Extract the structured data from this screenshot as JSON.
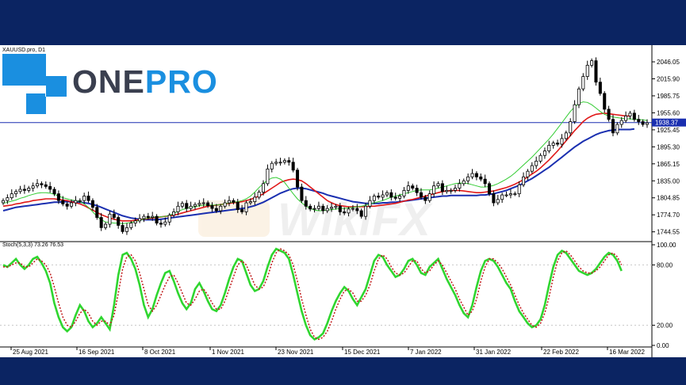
{
  "symbol_label": "XAUUSD.pro, D1",
  "brand": {
    "prefix": "ONE",
    "suffix": "PRO"
  },
  "watermark": "WikiFX",
  "current_price": "1938.37",
  "colors": {
    "frame": "#0b2462",
    "candle": "#000000",
    "ma_fast": "#33cc33",
    "ma_mid": "#e01818",
    "ma_slow": "#1a2fb0",
    "stoch_main": "#2fd62f",
    "stoch_signal": "#c01818",
    "price_line": "#1a2fb0",
    "brand_blue": "#1a8fe0",
    "brand_dark": "#3a3f4f"
  },
  "chart_data": [
    {
      "type": "candlestick",
      "title": "XAUUSD.pro, D1",
      "ylim": [
        1730,
        2070
      ],
      "y_ticks": [
        "2046.05",
        "2015.90",
        "1985.75",
        "1955.60",
        "1925.45",
        "1895.30",
        "1865.15",
        "1835.00",
        "1804.85",
        "1774.70",
        "1744.55"
      ],
      "x_ticks": [
        "25 Aug 2021",
        "16 Sep 2021",
        "8 Oct 2021",
        "1 Nov 2021",
        "23 Nov 2021",
        "15 Dec 2021",
        "7 Jan 2022",
        "31 Jan 2022",
        "22 Feb 2022",
        "16 Mar 2022"
      ],
      "close": [
        1800,
        1805,
        1812,
        1816,
        1820,
        1818,
        1822,
        1826,
        1830,
        1828,
        1825,
        1820,
        1812,
        1800,
        1794,
        1790,
        1796,
        1800,
        1800,
        1808,
        1800,
        1788,
        1770,
        1752,
        1758,
        1776,
        1770,
        1756,
        1745,
        1752,
        1760,
        1764,
        1768,
        1772,
        1770,
        1772,
        1760,
        1758,
        1762,
        1774,
        1780,
        1790,
        1795,
        1786,
        1790,
        1793,
        1795,
        1796,
        1791,
        1786,
        1782,
        1790,
        1796,
        1800,
        1797,
        1784,
        1780,
        1796,
        1798,
        1806,
        1815,
        1830,
        1856,
        1866,
        1868,
        1868,
        1871,
        1868,
        1854,
        1824,
        1800,
        1790,
        1785,
        1786,
        1790,
        1782,
        1786,
        1788,
        1790,
        1780,
        1778,
        1785,
        1786,
        1782,
        1772,
        1790,
        1800,
        1808,
        1806,
        1810,
        1814,
        1806,
        1804,
        1808,
        1818,
        1826,
        1822,
        1814,
        1806,
        1800,
        1812,
        1826,
        1830,
        1816,
        1818,
        1818,
        1822,
        1830,
        1835,
        1842,
        1848,
        1842,
        1838,
        1830,
        1812,
        1796,
        1802,
        1810,
        1810,
        1812,
        1812,
        1828,
        1842,
        1852,
        1862,
        1870,
        1880,
        1888,
        1898,
        1902,
        1900,
        1910,
        1920,
        1940,
        1970,
        1998,
        2020,
        2040,
        2048,
        2010,
        1990,
        1962,
        1944,
        1920,
        1935,
        1942,
        1950,
        1955,
        1944,
        1940,
        1935,
        1938
      ],
      "ma_fast": [
        1795,
        1797,
        1799,
        1801,
        1804,
        1806,
        1809,
        1811,
        1813,
        1814,
        1814,
        1813,
        1811,
        1808,
        1805,
        1803,
        1801,
        1800,
        1798,
        1794,
        1788,
        1780,
        1772,
        1766,
        1762,
        1761,
        1760,
        1760,
        1759,
        1760,
        1761,
        1763,
        1765,
        1767,
        1769,
        1770,
        1771,
        1771,
        1772,
        1774,
        1777,
        1781,
        1784,
        1786,
        1788,
        1789,
        1791,
        1792,
        1792,
        1792,
        1792,
        1793,
        1794,
        1796,
        1797,
        1798,
        1800,
        1803,
        1808,
        1815,
        1823,
        1830,
        1836,
        1840,
        1841,
        1838,
        1832,
        1822,
        1812,
        1803,
        1796,
        1790,
        1786,
        1783,
        1782,
        1782,
        1783,
        1784,
        1785,
        1786,
        1786,
        1787,
        1788,
        1789,
        1790,
        1792,
        1794,
        1796,
        1798,
        1800,
        1803,
        1806,
        1808,
        1810,
        1812,
        1814,
        1816,
        1818,
        1819,
        1819,
        1819,
        1820,
        1822,
        1824,
        1826,
        1828,
        1830,
        1831,
        1831,
        1830,
        1828,
        1826,
        1824,
        1824,
        1825,
        1827,
        1830,
        1834,
        1838,
        1843,
        1849,
        1856,
        1863,
        1870,
        1877,
        1885,
        1893,
        1901,
        1909,
        1918,
        1928,
        1938,
        1948,
        1958,
        1966,
        1972,
        1975,
        1974,
        1970,
        1964,
        1958,
        1953,
        1950,
        1948,
        1947,
        1946,
        1945,
        1945,
        1944,
        1944,
        1943,
        1942
      ],
      "ma_mid": [
        1790,
        1791,
        1792,
        1794,
        1795,
        1797,
        1798,
        1800,
        1801,
        1802,
        1803,
        1803,
        1803,
        1802,
        1801,
        1800,
        1798,
        1796,
        1794,
        1791,
        1787,
        1783,
        1779,
        1775,
        1772,
        1769,
        1767,
        1765,
        1764,
        1764,
        1764,
        1765,
        1766,
        1767,
        1768,
        1769,
        1770,
        1771,
        1772,
        1773,
        1774,
        1776,
        1778,
        1780,
        1782,
        1784,
        1786,
        1788,
        1790,
        1791,
        1792,
        1793,
        1794,
        1795,
        1796,
        1797,
        1798,
        1800,
        1802,
        1805,
        1808,
        1812,
        1817,
        1822,
        1827,
        1832,
        1835,
        1837,
        1838,
        1837,
        1835,
        1830,
        1824,
        1818,
        1812,
        1806,
        1800,
        1796,
        1793,
        1791,
        1790,
        1789,
        1789,
        1789,
        1789,
        1789,
        1790,
        1790,
        1791,
        1792,
        1793,
        1794,
        1795,
        1797,
        1799,
        1801,
        1802,
        1804,
        1806,
        1808,
        1810,
        1812,
        1814,
        1816,
        1817,
        1818,
        1818,
        1818,
        1817,
        1816,
        1815,
        1814,
        1814,
        1815,
        1816,
        1817,
        1819,
        1821,
        1823,
        1826,
        1829,
        1833,
        1837,
        1842,
        1847,
        1852,
        1858,
        1865,
        1872,
        1880,
        1888,
        1897,
        1906,
        1915,
        1924,
        1932,
        1940,
        1946,
        1950,
        1953,
        1954,
        1955,
        1954,
        1953,
        1952,
        1951,
        1950,
        1950
      ],
      "ma_slow": [
        1782,
        1784,
        1786,
        1788,
        1789,
        1790,
        1791,
        1792,
        1793,
        1794,
        1795,
        1796,
        1797,
        1797,
        1798,
        1798,
        1798,
        1798,
        1797,
        1796,
        1795,
        1793,
        1791,
        1788,
        1785,
        1782,
        1779,
        1776,
        1773,
        1771,
        1769,
        1768,
        1767,
        1766,
        1766,
        1766,
        1766,
        1767,
        1768,
        1769,
        1770,
        1771,
        1772,
        1773,
        1774,
        1775,
        1776,
        1777,
        1778,
        1779,
        1780,
        1781,
        1782,
        1783,
        1784,
        1785,
        1786,
        1787,
        1789,
        1791,
        1794,
        1797,
        1801,
        1805,
        1809,
        1813,
        1816,
        1819,
        1821,
        1822,
        1822,
        1821,
        1819,
        1817,
        1815,
        1813,
        1810,
        1808,
        1806,
        1804,
        1802,
        1800,
        1798,
        1797,
        1796,
        1795,
        1795,
        1795,
        1795,
        1796,
        1796,
        1797,
        1797,
        1798,
        1799,
        1800,
        1801,
        1802,
        1803,
        1804,
        1805,
        1806,
        1807,
        1808,
        1808,
        1809,
        1809,
        1809,
        1809,
        1809,
        1809,
        1809,
        1810,
        1810,
        1811,
        1812,
        1814,
        1816,
        1818,
        1821,
        1824,
        1827,
        1831,
        1835,
        1839,
        1844,
        1849,
        1854,
        1859,
        1865,
        1871,
        1877,
        1883,
        1889,
        1895,
        1900,
        1905,
        1909,
        1913,
        1917,
        1920,
        1922,
        1924,
        1925,
        1926,
        1926,
        1926,
        1926,
        1927
      ]
    },
    {
      "type": "line",
      "title": "Stoch(5,3,3) 73.26 76.53",
      "ylim": [
        0,
        100
      ],
      "y_ticks": [
        "100.00",
        "80.00",
        "20.00",
        "0.00"
      ],
      "series": [
        {
          "name": "main",
          "values": [
            80,
            78,
            82,
            86,
            80,
            76,
            80,
            86,
            88,
            82,
            74,
            62,
            42,
            28,
            18,
            14,
            18,
            30,
            40,
            34,
            24,
            18,
            22,
            28,
            22,
            16,
            40,
            70,
            90,
            92,
            86,
            76,
            60,
            40,
            28,
            36,
            50,
            62,
            72,
            74,
            64,
            52,
            42,
            36,
            42,
            56,
            62,
            54,
            44,
            36,
            34,
            40,
            52,
            66,
            78,
            86,
            84,
            72,
            60,
            54,
            56,
            64,
            78,
            90,
            96,
            94,
            92,
            86,
            70,
            52,
            34,
            20,
            10,
            6,
            8,
            12,
            22,
            34,
            44,
            52,
            58,
            54,
            46,
            40,
            48,
            56,
            70,
            84,
            90,
            88,
            80,
            74,
            68,
            70,
            76,
            84,
            86,
            80,
            72,
            70,
            78,
            82,
            86,
            76,
            66,
            58,
            50,
            40,
            32,
            28,
            40,
            58,
            74,
            84,
            86,
            84,
            78,
            70,
            62,
            56,
            44,
            34,
            28,
            22,
            18,
            20,
            26,
            40,
            60,
            78,
            90,
            94,
            92,
            86,
            80,
            74,
            72,
            70,
            72,
            76,
            82,
            88,
            92,
            90,
            84,
            74
          ]
        },
        {
          "name": "signal",
          "values": [
            78,
            78,
            80,
            82,
            82,
            78,
            78,
            82,
            86,
            84,
            80,
            72,
            58,
            42,
            28,
            20,
            18,
            24,
            32,
            36,
            32,
            24,
            20,
            24,
            24,
            20,
            30,
            52,
            76,
            88,
            90,
            84,
            72,
            56,
            40,
            34,
            40,
            50,
            60,
            68,
            70,
            62,
            52,
            42,
            40,
            46,
            54,
            56,
            50,
            42,
            36,
            36,
            44,
            56,
            68,
            80,
            84,
            80,
            70,
            60,
            56,
            58,
            68,
            82,
            92,
            96,
            94,
            90,
            80,
            64,
            46,
            30,
            16,
            8,
            6,
            8,
            14,
            24,
            36,
            46,
            54,
            56,
            52,
            44,
            44,
            50,
            60,
            74,
            86,
            90,
            86,
            78,
            72,
            70,
            72,
            78,
            84,
            84,
            76,
            72,
            74,
            80,
            84,
            80,
            72,
            64,
            56,
            46,
            38,
            30,
            34,
            46,
            64,
            78,
            86,
            86,
            82,
            76,
            68,
            60,
            50,
            40,
            32,
            26,
            20,
            18,
            22,
            32,
            48,
            68,
            84,
            92,
            94,
            90,
            84,
            78,
            74,
            72,
            72,
            74,
            78,
            84,
            90,
            92,
            88,
            80
          ]
        }
      ]
    }
  ]
}
